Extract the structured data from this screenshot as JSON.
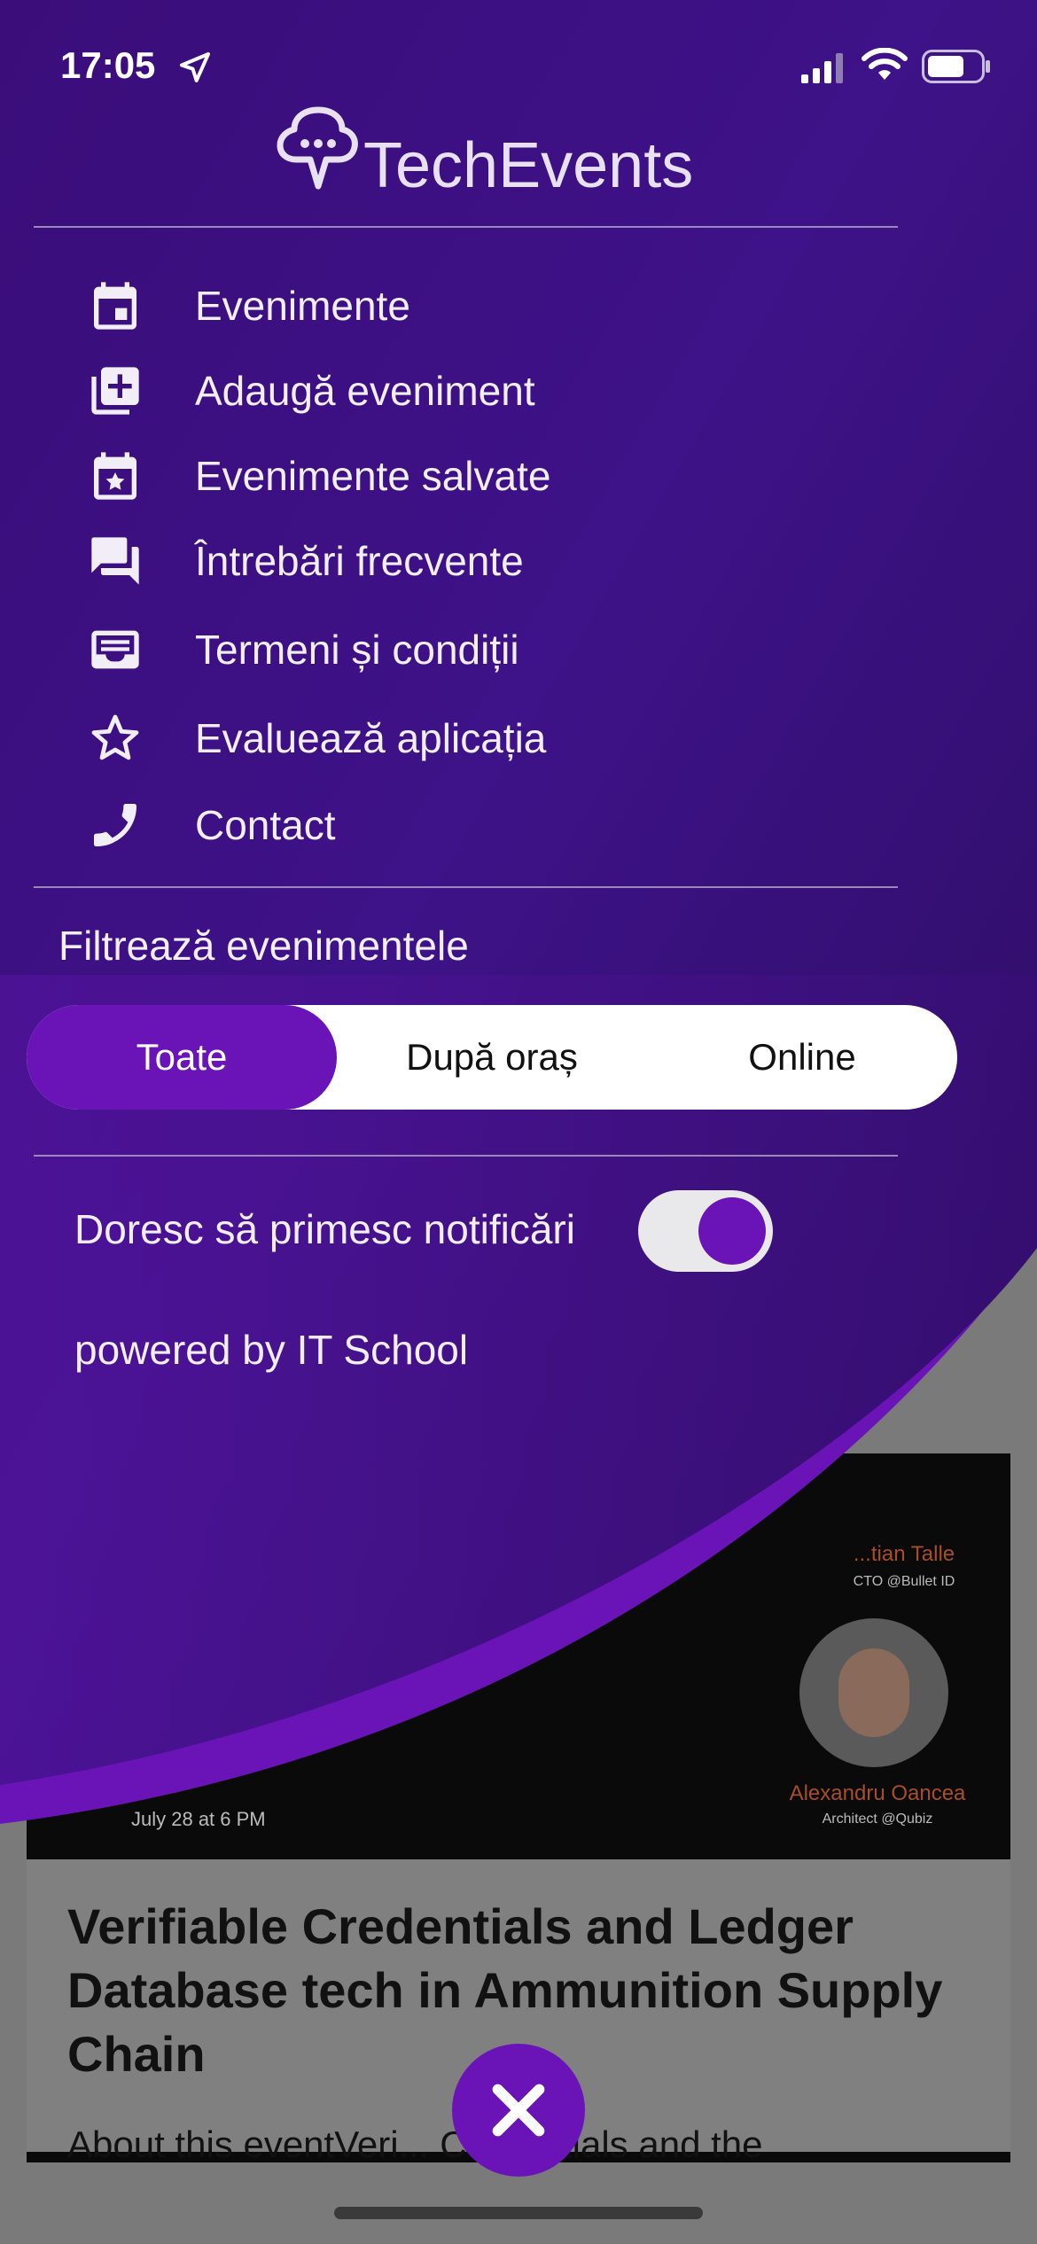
{
  "status_bar": {
    "time": "17:05"
  },
  "app": {
    "title": "TechEvents"
  },
  "menu": {
    "items": [
      {
        "label": "Evenimente",
        "icon": "calendar-icon"
      },
      {
        "label": "Adaugă eveniment",
        "icon": "add-box-icon"
      },
      {
        "label": "Evenimente salvate",
        "icon": "calendar-star-icon"
      },
      {
        "label": "Întrebări frecvente",
        "icon": "forum-icon"
      },
      {
        "label": "Termeni și condiții",
        "icon": "inbox-icon"
      },
      {
        "label": "Evaluează aplicația",
        "icon": "star-outline-icon"
      },
      {
        "label": "Contact",
        "icon": "phone-icon"
      }
    ]
  },
  "filter": {
    "title": "Filtrează evenimentele",
    "options": [
      "Toate",
      "După oraș",
      "Online"
    ],
    "selected": "Toate"
  },
  "notifications": {
    "label": "Doresc să primesc notificări",
    "enabled": true
  },
  "footer": {
    "powered_by": "powered by IT School"
  },
  "background_event": {
    "speaker1_name": "...tian Talle",
    "speaker1_role": "CTO @Bullet ID",
    "speaker2_name": "Alexandru Oancea",
    "speaker2_role": "Architect @Qubiz",
    "date": "July 28 at 6 PM",
    "title": "Verifiable Credentials and Ledger Database tech in Ammunition Supply Chain",
    "description": "About this eventVeri... Credentials and the"
  },
  "colors": {
    "accent": "#6a14b8",
    "menu_bg_top": "#2a0f5c",
    "menu_bg_bottom": "#5a16a8"
  }
}
